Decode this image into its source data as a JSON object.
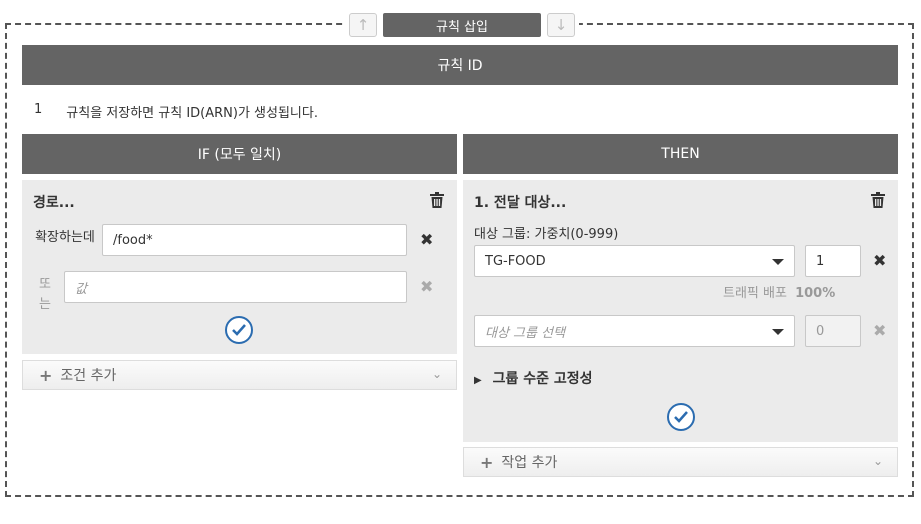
{
  "toolbar": {
    "up_arrow": "↑",
    "down_arrow": "↓",
    "insert_label": "규칙 삽입"
  },
  "rule_id": {
    "header": "규칙 ID",
    "number": "1",
    "message": "규칙을 저장하면 규칙 ID(ARN)가 생성됩니다."
  },
  "if_section": {
    "header": "IF (모두 일치)",
    "condition_title": "경로...",
    "match_label": "확장하는데",
    "match_value": "/food*",
    "or_label": "또는",
    "or_placeholder": "값",
    "add_condition": "조건 추가"
  },
  "then_section": {
    "header": "THEN",
    "action_title": "1. 전달 대상...",
    "target_group_label": "대상 그룹: 가중치(0-999)",
    "target_group_value": "TG-FOOD",
    "weight_value": "1",
    "traffic_label": "트래픽 배포",
    "traffic_value": "100%",
    "target_group_placeholder": "대상 그룹 선택",
    "weight_placeholder": "0",
    "stickiness_label": "그룹 수준 고정성",
    "add_action": "작업 추가"
  },
  "colors": {
    "header_bg": "#646464",
    "panel_bg": "#ebebeb",
    "accent": "#2b6cb0"
  }
}
